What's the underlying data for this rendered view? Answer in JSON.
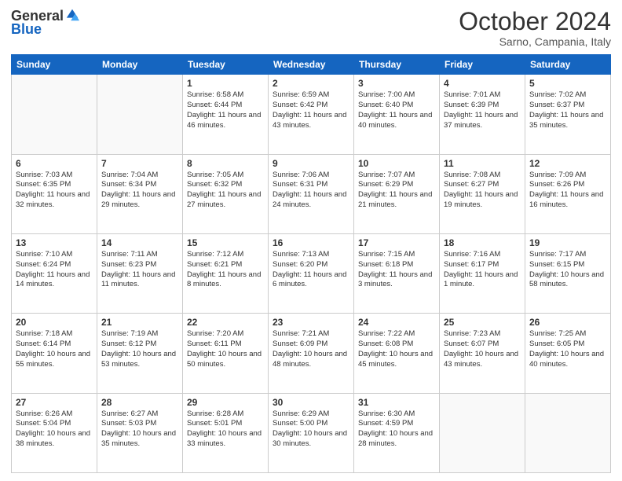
{
  "logo": {
    "general": "General",
    "blue": "Blue"
  },
  "title": "October 2024",
  "location": "Sarno, Campania, Italy",
  "days_header": [
    "Sunday",
    "Monday",
    "Tuesday",
    "Wednesday",
    "Thursday",
    "Friday",
    "Saturday"
  ],
  "weeks": [
    [
      {
        "day": "",
        "info": ""
      },
      {
        "day": "",
        "info": ""
      },
      {
        "day": "1",
        "info": "Sunrise: 6:58 AM\nSunset: 6:44 PM\nDaylight: 11 hours and 46 minutes."
      },
      {
        "day": "2",
        "info": "Sunrise: 6:59 AM\nSunset: 6:42 PM\nDaylight: 11 hours and 43 minutes."
      },
      {
        "day": "3",
        "info": "Sunrise: 7:00 AM\nSunset: 6:40 PM\nDaylight: 11 hours and 40 minutes."
      },
      {
        "day": "4",
        "info": "Sunrise: 7:01 AM\nSunset: 6:39 PM\nDaylight: 11 hours and 37 minutes."
      },
      {
        "day": "5",
        "info": "Sunrise: 7:02 AM\nSunset: 6:37 PM\nDaylight: 11 hours and 35 minutes."
      }
    ],
    [
      {
        "day": "6",
        "info": "Sunrise: 7:03 AM\nSunset: 6:35 PM\nDaylight: 11 hours and 32 minutes."
      },
      {
        "day": "7",
        "info": "Sunrise: 7:04 AM\nSunset: 6:34 PM\nDaylight: 11 hours and 29 minutes."
      },
      {
        "day": "8",
        "info": "Sunrise: 7:05 AM\nSunset: 6:32 PM\nDaylight: 11 hours and 27 minutes."
      },
      {
        "day": "9",
        "info": "Sunrise: 7:06 AM\nSunset: 6:31 PM\nDaylight: 11 hours and 24 minutes."
      },
      {
        "day": "10",
        "info": "Sunrise: 7:07 AM\nSunset: 6:29 PM\nDaylight: 11 hours and 21 minutes."
      },
      {
        "day": "11",
        "info": "Sunrise: 7:08 AM\nSunset: 6:27 PM\nDaylight: 11 hours and 19 minutes."
      },
      {
        "day": "12",
        "info": "Sunrise: 7:09 AM\nSunset: 6:26 PM\nDaylight: 11 hours and 16 minutes."
      }
    ],
    [
      {
        "day": "13",
        "info": "Sunrise: 7:10 AM\nSunset: 6:24 PM\nDaylight: 11 hours and 14 minutes."
      },
      {
        "day": "14",
        "info": "Sunrise: 7:11 AM\nSunset: 6:23 PM\nDaylight: 11 hours and 11 minutes."
      },
      {
        "day": "15",
        "info": "Sunrise: 7:12 AM\nSunset: 6:21 PM\nDaylight: 11 hours and 8 minutes."
      },
      {
        "day": "16",
        "info": "Sunrise: 7:13 AM\nSunset: 6:20 PM\nDaylight: 11 hours and 6 minutes."
      },
      {
        "day": "17",
        "info": "Sunrise: 7:15 AM\nSunset: 6:18 PM\nDaylight: 11 hours and 3 minutes."
      },
      {
        "day": "18",
        "info": "Sunrise: 7:16 AM\nSunset: 6:17 PM\nDaylight: 11 hours and 1 minute."
      },
      {
        "day": "19",
        "info": "Sunrise: 7:17 AM\nSunset: 6:15 PM\nDaylight: 10 hours and 58 minutes."
      }
    ],
    [
      {
        "day": "20",
        "info": "Sunrise: 7:18 AM\nSunset: 6:14 PM\nDaylight: 10 hours and 55 minutes."
      },
      {
        "day": "21",
        "info": "Sunrise: 7:19 AM\nSunset: 6:12 PM\nDaylight: 10 hours and 53 minutes."
      },
      {
        "day": "22",
        "info": "Sunrise: 7:20 AM\nSunset: 6:11 PM\nDaylight: 10 hours and 50 minutes."
      },
      {
        "day": "23",
        "info": "Sunrise: 7:21 AM\nSunset: 6:09 PM\nDaylight: 10 hours and 48 minutes."
      },
      {
        "day": "24",
        "info": "Sunrise: 7:22 AM\nSunset: 6:08 PM\nDaylight: 10 hours and 45 minutes."
      },
      {
        "day": "25",
        "info": "Sunrise: 7:23 AM\nSunset: 6:07 PM\nDaylight: 10 hours and 43 minutes."
      },
      {
        "day": "26",
        "info": "Sunrise: 7:25 AM\nSunset: 6:05 PM\nDaylight: 10 hours and 40 minutes."
      }
    ],
    [
      {
        "day": "27",
        "info": "Sunrise: 6:26 AM\nSunset: 5:04 PM\nDaylight: 10 hours and 38 minutes."
      },
      {
        "day": "28",
        "info": "Sunrise: 6:27 AM\nSunset: 5:03 PM\nDaylight: 10 hours and 35 minutes."
      },
      {
        "day": "29",
        "info": "Sunrise: 6:28 AM\nSunset: 5:01 PM\nDaylight: 10 hours and 33 minutes."
      },
      {
        "day": "30",
        "info": "Sunrise: 6:29 AM\nSunset: 5:00 PM\nDaylight: 10 hours and 30 minutes."
      },
      {
        "day": "31",
        "info": "Sunrise: 6:30 AM\nSunset: 4:59 PM\nDaylight: 10 hours and 28 minutes."
      },
      {
        "day": "",
        "info": ""
      },
      {
        "day": "",
        "info": ""
      }
    ]
  ]
}
